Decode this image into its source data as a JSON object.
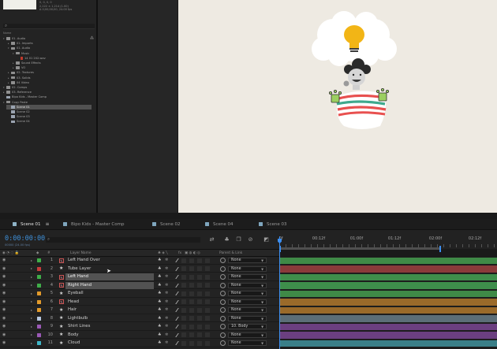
{
  "project": {
    "thumb_meta": [
      "0, 0, 0, 0",
      "2,222 × 1,214 (1.00)",
      "Δ 0;00;00;00, 24.00 fps"
    ],
    "header": "Name",
    "tree": [
      {
        "label": "01. Audio",
        "indent": 0,
        "kind": "folder",
        "arrow": "▾"
      },
      {
        "label": "01. Imports",
        "indent": 1,
        "kind": "folder",
        "arrow": "▸"
      },
      {
        "label": "01. Audio",
        "indent": 1,
        "kind": "folder",
        "arrow": "▾"
      },
      {
        "label": "Music",
        "indent": 2,
        "kind": "folder",
        "arrow": "▾"
      },
      {
        "label": "14 01 202.wav",
        "indent": 3,
        "kind": "fileR",
        "arrow": ""
      },
      {
        "label": "Sound Effects",
        "indent": 2,
        "kind": "folder",
        "arrow": "▸"
      },
      {
        "label": "VO",
        "indent": 2,
        "kind": "folder",
        "arrow": "▸"
      },
      {
        "label": "02. Textures",
        "indent": 1,
        "kind": "folder",
        "arrow": "▸"
      },
      {
        "label": "03. Solids",
        "indent": 1,
        "kind": "folder",
        "arrow": "▸"
      },
      {
        "label": "04 Video",
        "indent": 1,
        "kind": "folder",
        "arrow": "▸"
      },
      {
        "label": "02. Comps",
        "indent": 0,
        "kind": "folder",
        "arrow": "▾"
      },
      {
        "label": "03. Reference",
        "indent": 0,
        "kind": "folder",
        "arrow": "▸"
      },
      {
        "label": "Bipo Kids - Master Comp",
        "indent": 0,
        "kind": "comp",
        "arrow": ""
      },
      {
        "label": "Copy Paste",
        "indent": 0,
        "kind": "folder",
        "arrow": "▾"
      },
      {
        "label": "Scene 01",
        "indent": 1,
        "kind": "comp",
        "arrow": "",
        "selected": true
      },
      {
        "label": "Scene 02",
        "indent": 1,
        "kind": "comp",
        "arrow": ""
      },
      {
        "label": "Scene 03",
        "indent": 1,
        "kind": "comp",
        "arrow": ""
      },
      {
        "label": "Scene 04",
        "indent": 1,
        "kind": "comp",
        "arrow": ""
      }
    ]
  },
  "viewer": {
    "background": "#eeeae2"
  },
  "tabs": [
    {
      "label": "Scene 01",
      "color": "#8fb3c7",
      "active": true,
      "menu": "≡"
    },
    {
      "label": "Bipo Kids - Master Comp",
      "color": "#7fa6be",
      "active": false
    },
    {
      "label": "Scene 02",
      "color": "#7fa6be",
      "active": false
    },
    {
      "label": "Scene 04",
      "color": "#7fa6be",
      "active": false
    },
    {
      "label": "Scene 03",
      "color": "#7fa6be",
      "active": false
    }
  ],
  "timeline": {
    "timecode": "0:00:00:00",
    "fps": "00000 (24.00 fps)",
    "search_glyph": "⌕",
    "ruler": [
      "0f",
      "00:12f",
      "01:00f",
      "01:12f",
      "02:00f",
      "02:12f"
    ],
    "headers": {
      "num": "#",
      "name": "Layer Name",
      "fx": "fx",
      "parent": "Parent & Link"
    },
    "playhead_accent": "#3c8ef0"
  },
  "layers": [
    {
      "num": "1",
      "name": "Left Hand Over",
      "label_color": "#3fae49",
      "icon": "shape",
      "parent": "None",
      "bar": "#3f8a47",
      "selected": false
    },
    {
      "num": "2",
      "name": "Tube Layer",
      "label_color": "#c83c3c",
      "icon": "star",
      "parent": "None",
      "bar": "#8a3a3a",
      "selected": false
    },
    {
      "num": "3",
      "name": "Left Hand",
      "label_color": "#3fae49",
      "icon": "shape",
      "parent": "None",
      "bar": "#3e8e4b",
      "selected": true
    },
    {
      "num": "4",
      "name": "Right Hand",
      "label_color": "#3fae49",
      "icon": "shape",
      "parent": "None",
      "bar": "#3e8e4b",
      "selected": true
    },
    {
      "num": "5",
      "name": "Eyeball",
      "label_color": "#e39b2b",
      "icon": "star",
      "parent": "None",
      "bar": "#3f8a47",
      "selected": false
    },
    {
      "num": "6",
      "name": "Head",
      "label_color": "#e39b2b",
      "icon": "shape",
      "parent": "None",
      "bar": "#9a6a2a",
      "selected": false
    },
    {
      "num": "7",
      "name": "Hair",
      "label_color": "#e39b2b",
      "icon": "star",
      "parent": "None",
      "bar": "#9a6a2a",
      "selected": false
    },
    {
      "num": "8",
      "name": "Lightbulb",
      "label_color": "#b7c8e0",
      "icon": "star",
      "parent": "None",
      "bar": "#5c6e78",
      "selected": false
    },
    {
      "num": "9",
      "name": "Shirt Lines",
      "label_color": "#9b59b6",
      "icon": "star",
      "parent": "10. Body",
      "bar": "#6b3f80",
      "selected": false
    },
    {
      "num": "10",
      "name": "Body",
      "label_color": "#9b59b6",
      "icon": "star",
      "parent": "None",
      "bar": "#6b3f80",
      "selected": false
    },
    {
      "num": "11",
      "name": "Cloud",
      "label_color": "#3fb6c8",
      "icon": "star",
      "parent": "None",
      "bar": "#3a7f88",
      "selected": false
    }
  ]
}
